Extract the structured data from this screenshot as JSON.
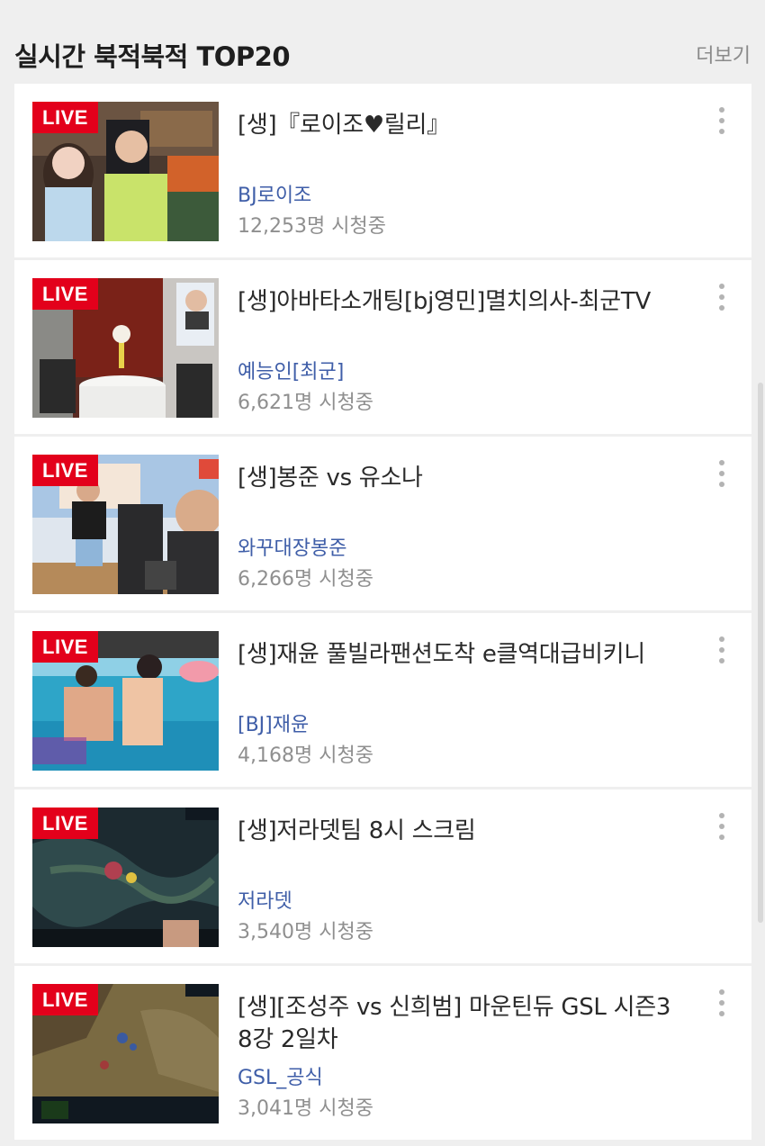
{
  "header": {
    "title": "실시간 북적북적 TOP20",
    "more": "더보기"
  },
  "live_label": "LIVE",
  "colors": {
    "live_badge": "#e3001b",
    "channel_link": "#3f5ea8",
    "viewers": "#8f8f8f"
  },
  "items": [
    {
      "title": "[생]『로이조♥릴리』",
      "channel": "BJ로이조",
      "viewers": "12,253명 시청중"
    },
    {
      "title": "[생]아바타소개팅[bj영민]멸치의사-최군TV",
      "channel": "예능인[최군]",
      "viewers": "6,621명 시청중"
    },
    {
      "title": "[생]봉준 vs 유소나",
      "channel": "와꾸대장봉준",
      "viewers": "6,266명 시청중"
    },
    {
      "title": "[생]재윤 풀빌라팬션도착 e클역대급비키니",
      "channel": "[BJ]재윤",
      "viewers": "4,168명 시청중"
    },
    {
      "title": "[생]저라뎃팀 8시 스크림",
      "channel": "저라뎃",
      "viewers": "3,540명 시청중"
    },
    {
      "title": "[생][조성주 vs 신희범] 마운틴듀 GSL 시즌3 8강 2일차",
      "channel": "GSL_공식",
      "viewers": "3,041명 시청중"
    }
  ]
}
